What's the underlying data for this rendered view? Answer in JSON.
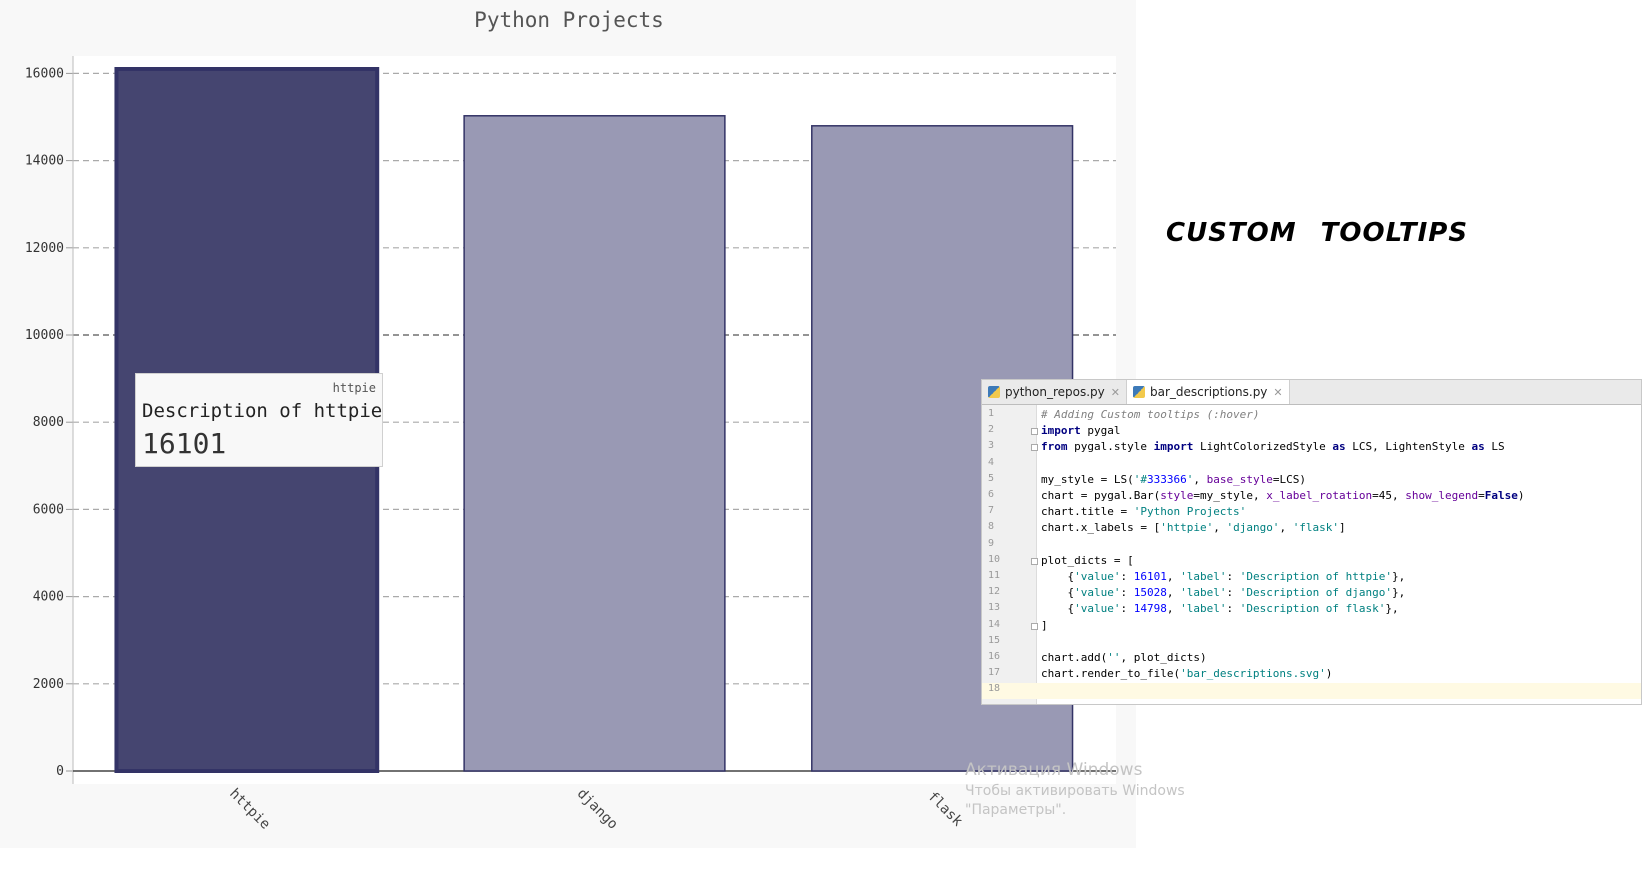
{
  "chart": {
    "title": "Python Projects",
    "tooltip": {
      "x_label": "httpie",
      "label": "Description of httpie",
      "value": "16101"
    }
  },
  "chart_data": {
    "type": "bar",
    "title": "Python Projects",
    "categories": [
      "httpie",
      "django",
      "flask"
    ],
    "values": [
      16101,
      15028,
      14798
    ],
    "series": [
      {
        "values": [
          16101,
          15028,
          14798
        ]
      }
    ],
    "ylim": [
      0,
      16101
    ],
    "yticks": [
      0,
      2000,
      4000,
      6000,
      8000,
      10000,
      12000,
      14000,
      16000
    ],
    "grid": true,
    "legend": "none",
    "highlighted_bar": "httpie",
    "colors": {
      "bar": "#9999b4",
      "bar_hover": "#454570",
      "stroke": "#333366"
    }
  },
  "heading": "CUSTOM TOOLTIPS",
  "ide": {
    "tabs": [
      {
        "label": "python_repos.py",
        "active": false
      },
      {
        "label": "bar_descriptions.py",
        "active": true
      }
    ],
    "line_numbers": [
      "1",
      "2",
      "3",
      "4",
      "5",
      "6",
      "7",
      "8",
      "9",
      "10",
      "11",
      "12",
      "13",
      "14",
      "15",
      "16",
      "17",
      "18"
    ],
    "code_lines": [
      "# Adding Custom tooltips (:hover)",
      "import pygal",
      "from pygal.style import LightColorizedStyle as LCS, LightenStyle as LS",
      "",
      "my_style = LS('#333366', base_style=LCS)",
      "chart = pygal.Bar(style=my_style, x_label_rotation=45, show_legend=False)",
      "chart.title = 'Python Projects'",
      "chart.x_labels = ['httpie', 'django', 'flask']",
      "",
      "plot_dicts = [",
      "    {'value': 16101, 'label': 'Description of httpie'},",
      "    {'value': 15028, 'label': 'Description of django'},",
      "    {'value': 14798, 'label': 'Description of flask'},",
      "]",
      "",
      "chart.add('', plot_dicts)",
      "chart.render_to_file('bar_descriptions.svg')",
      ""
    ]
  },
  "watermark": {
    "line1": "Активация Windows",
    "line2": "Чтобы активировать Windows",
    "line3": "\"Параметры\"."
  }
}
